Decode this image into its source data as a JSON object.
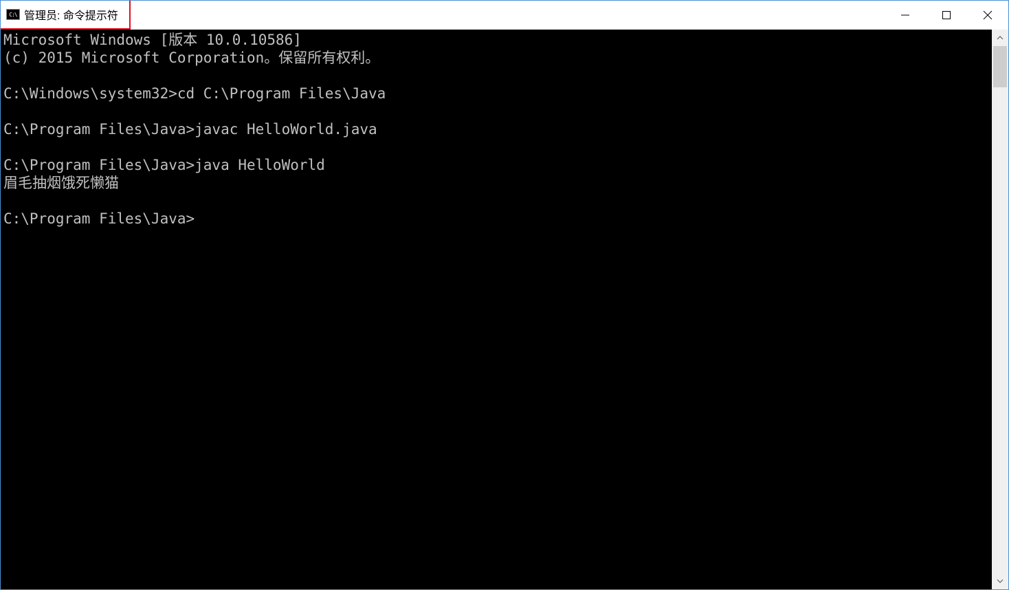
{
  "window": {
    "title": "管理员: 命令提示符",
    "icon_text": "C:\\"
  },
  "terminal": {
    "lines": [
      "Microsoft Windows [版本 10.0.10586]",
      "(c) 2015 Microsoft Corporation。保留所有权利。",
      "",
      "C:\\Windows\\system32>cd C:\\Program Files\\Java",
      "",
      "C:\\Program Files\\Java>javac HelloWorld.java",
      "",
      "C:\\Program Files\\Java>java HelloWorld",
      "眉毛抽烟饿死懒猫",
      "",
      "C:\\Program Files\\Java>"
    ]
  }
}
